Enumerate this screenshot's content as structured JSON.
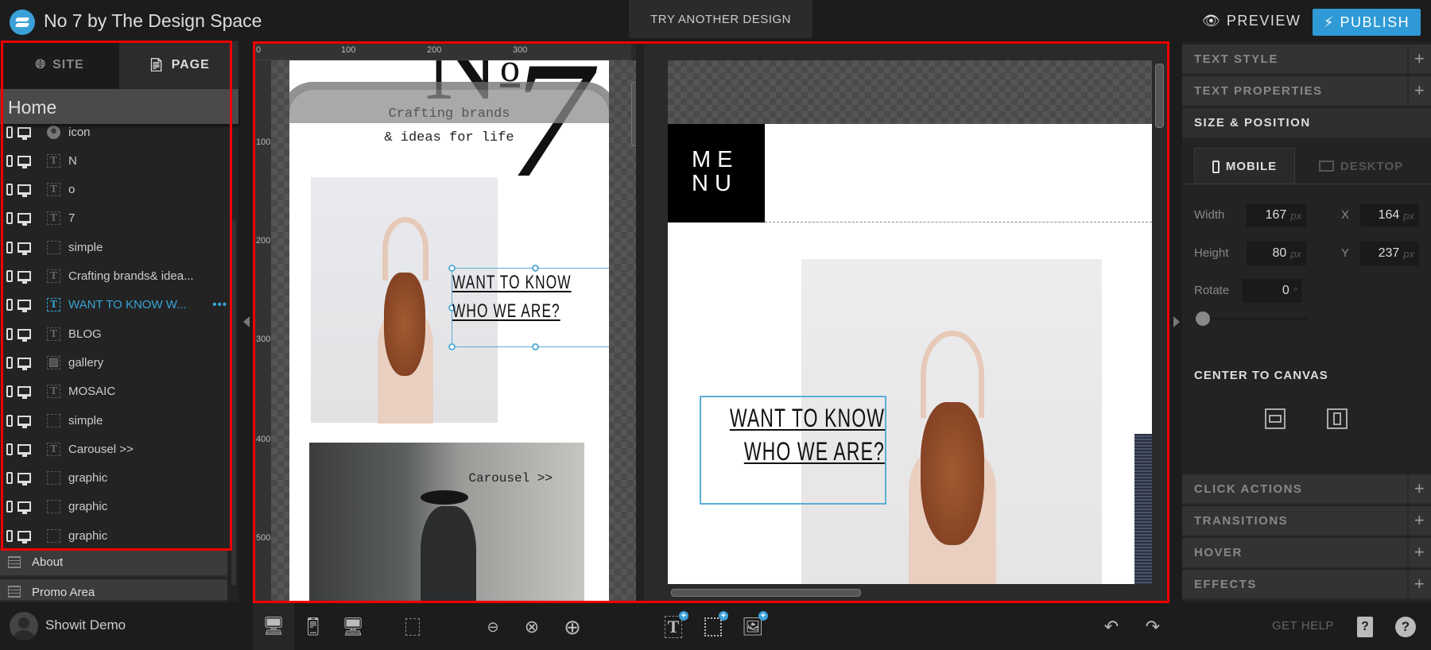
{
  "app": {
    "title": "No 7 by The Design Space",
    "try_another": "TRY ANOTHER DESIGN",
    "preview": "PREVIEW",
    "publish": "PUBLISH",
    "accent": "#2f9ad6"
  },
  "sidebar": {
    "tabs": [
      {
        "label": "SITE",
        "icon": "globe-icon"
      },
      {
        "label": "PAGE",
        "icon": "page-icon"
      }
    ],
    "page_title": "Home",
    "layers": [
      {
        "type": "icon",
        "label": "icon"
      },
      {
        "type": "text",
        "label": "N"
      },
      {
        "type": "text",
        "label": "o"
      },
      {
        "type": "text",
        "label": "7"
      },
      {
        "type": "shape",
        "label": "simple"
      },
      {
        "type": "text",
        "label": "Crafting brands& idea..."
      },
      {
        "type": "text",
        "label": "WANT TO KNOW W...",
        "selected": true,
        "more": "•••"
      },
      {
        "type": "text",
        "label": "BLOG"
      },
      {
        "type": "image",
        "label": "gallery"
      },
      {
        "type": "text",
        "label": "MOSAIC"
      },
      {
        "type": "shape",
        "label": "simple"
      },
      {
        "type": "text",
        "label": "Carousel >>"
      },
      {
        "type": "shape",
        "label": "graphic"
      },
      {
        "type": "shape",
        "label": "graphic"
      },
      {
        "type": "shape",
        "label": "graphic"
      }
    ],
    "pages": [
      "About",
      "Promo Area"
    ],
    "user": "Showit Demo"
  },
  "canvas": {
    "ruler_top": [
      "0",
      "100",
      "200",
      "300"
    ],
    "ruler_left": [
      "100",
      "200",
      "300",
      "400",
      "500"
    ],
    "mobile": {
      "logo": "N",
      "logo_sup": "o",
      "logo_num": "7",
      "tagline_1": "Crafting brands",
      "tagline_2": "& ideas for life",
      "headline_1": "WANT TO KNOW",
      "headline_2": "WHO WE ARE?",
      "carousel": "Carousel >>"
    },
    "desktop": {
      "menu_1": "ME",
      "menu_2": "NU",
      "headline_1": "WANT TO KNOW",
      "headline_2": "WHO WE ARE?"
    }
  },
  "panel": {
    "sections_top": [
      "TEXT STYLE",
      "TEXT PROPERTIES"
    ],
    "open_section": "SIZE & POSITION",
    "tabs": [
      "MOBILE",
      "DESKTOP"
    ],
    "fields": {
      "width": {
        "label": "Width",
        "value": "167",
        "unit": "px"
      },
      "height": {
        "label": "Height",
        "value": "80",
        "unit": "px"
      },
      "x": {
        "label": "X",
        "value": "164",
        "unit": "px"
      },
      "y": {
        "label": "Y",
        "value": "237",
        "unit": "px"
      },
      "rotate": {
        "label": "Rotate",
        "value": "0",
        "unit": "°"
      }
    },
    "rotate_slider_fraction": 0,
    "center_to_canvas": "CENTER TO CANVAS",
    "sections_bottom": [
      "CLICK ACTIONS",
      "TRANSITIONS",
      "HOVER",
      "EFFECTS"
    ],
    "plus": "+"
  },
  "toolbar": {
    "get_help": "GET HELP"
  }
}
